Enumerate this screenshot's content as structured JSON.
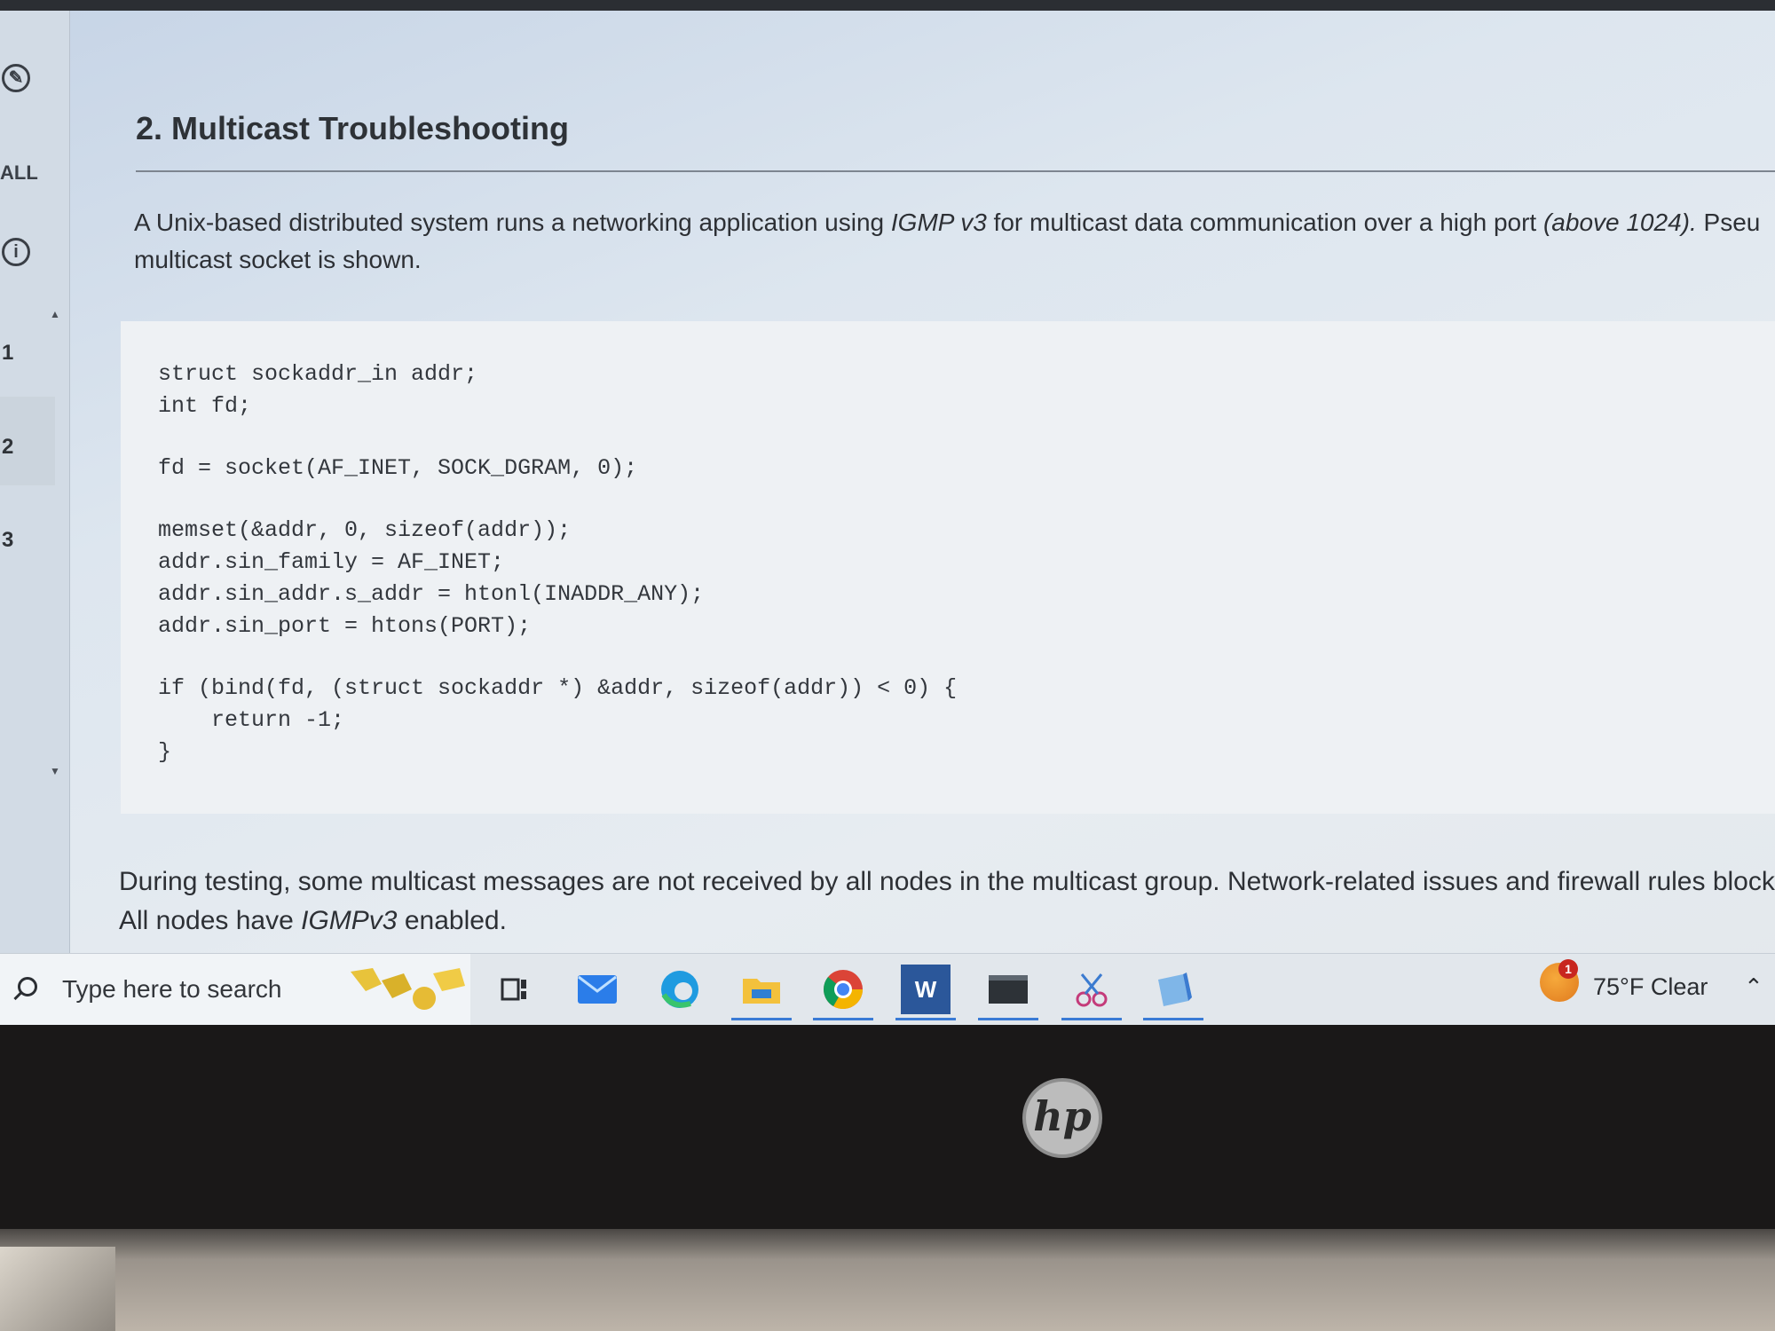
{
  "rail": {
    "all_label": "ALL",
    "numbers": [
      "1",
      "2",
      "3"
    ]
  },
  "question": {
    "title": "2. Multicast Troubleshooting",
    "intro": {
      "part1": "A Unix-based distributed system runs a networking application using ",
      "em1": "IGMP v3",
      "part2": " for multicast data communication over a high port ",
      "em2": "(above 1024).",
      "part3": " Pseu",
      "line2": "multicast socket is shown."
    },
    "code": [
      "struct sockaddr_in addr;",
      "int fd;",
      "",
      "fd = socket(AF_INET, SOCK_DGRAM, 0);",
      "",
      "memset(&addr, 0, sizeof(addr));",
      "addr.sin_family = AF_INET;",
      "addr.sin_addr.s_addr = htonl(INADDR_ANY);",
      "addr.sin_port = htons(PORT);",
      "",
      "if (bind(fd, (struct sockaddr *) &addr, sizeof(addr)) < 0) {",
      "    return -1;",
      "}"
    ],
    "note": {
      "line1": "During testing, some multicast messages are not received by all nodes in the multicast group. Network-related issues and firewall rules blockin",
      "line2_pre": "All nodes have ",
      "line2_em": "IGMPv3",
      "line2_post": " enabled."
    }
  },
  "taskbar": {
    "search_placeholder": "Type here to search",
    "weather": "75°F  Clear",
    "weather_badge": "1",
    "word_letter": "W",
    "icons": [
      "task-view-icon",
      "mail-icon",
      "edge-icon",
      "file-explorer-icon",
      "chrome-icon",
      "word-icon",
      "terminal-icon",
      "snipping-tool-icon",
      "notepad-icon"
    ],
    "accent": "#3a7bd5"
  },
  "device": {
    "logo": "hp"
  }
}
